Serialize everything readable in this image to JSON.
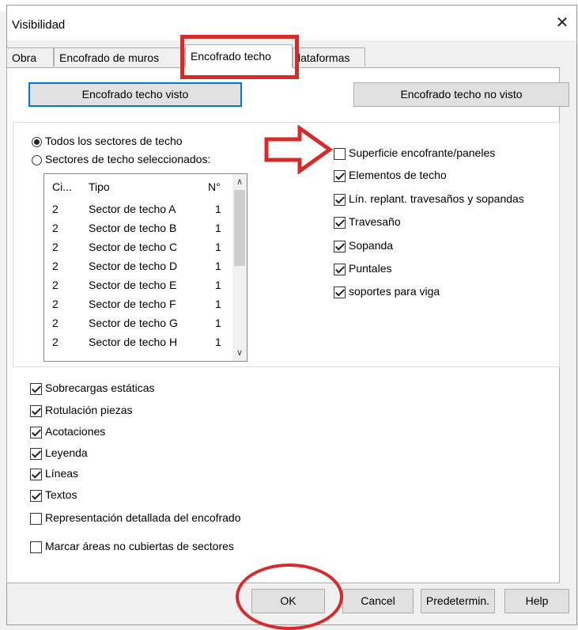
{
  "window": {
    "title": "Visibilidad",
    "close_glyph": "✕"
  },
  "tabs": [
    {
      "label": "Obra",
      "active": false
    },
    {
      "label": "Encofrado de muros",
      "active": false
    },
    {
      "label": "Encofrado techo",
      "active": true
    },
    {
      "label": "lataformas",
      "active": false
    }
  ],
  "top_buttons": {
    "visible": "Encofrado techo visto",
    "not_visible": "Encofrado techo no visto"
  },
  "sector_radios": [
    {
      "label": "Todos los sectores de techo",
      "selected": true
    },
    {
      "label": "Sectores de techo seleccionados:",
      "selected": false
    }
  ],
  "sector_list": {
    "headers": {
      "ci": "Ci...",
      "tipo": "Tipo",
      "n": "N°"
    },
    "rows": [
      {
        "ci": "2",
        "tipo": "Sector de techo A",
        "n": "1"
      },
      {
        "ci": "2",
        "tipo": "Sector de techo B",
        "n": "1"
      },
      {
        "ci": "2",
        "tipo": "Sector de techo C",
        "n": "1"
      },
      {
        "ci": "2",
        "tipo": "Sector de techo D",
        "n": "1"
      },
      {
        "ci": "2",
        "tipo": "Sector de techo E",
        "n": "1"
      },
      {
        "ci": "2",
        "tipo": "Sector de techo F",
        "n": "1"
      },
      {
        "ci": "2",
        "tipo": "Sector de techo G",
        "n": "1"
      },
      {
        "ci": "2",
        "tipo": "Sector de techo H",
        "n": "1"
      }
    ]
  },
  "element_checks": [
    {
      "label": "Superficie encofrante/paneles",
      "checked": false
    },
    {
      "label": "Elementos de techo",
      "checked": true
    },
    {
      "label": "Lín. replant. travesaños y sopandas",
      "checked": true
    },
    {
      "label": "Travesaño",
      "checked": true
    },
    {
      "label": "Sopanda",
      "checked": true
    },
    {
      "label": "Puntales",
      "checked": true
    },
    {
      "label": "soportes para viga",
      "checked": true
    }
  ],
  "general_checks": [
    {
      "label": "Sobrecargas estáticas",
      "checked": true
    },
    {
      "label": "Rotulación piezas",
      "checked": true
    },
    {
      "label": "Acotaciones",
      "checked": true
    },
    {
      "label": "Leyenda",
      "checked": true
    },
    {
      "label": "Líneas",
      "checked": true
    },
    {
      "label": "Textos",
      "checked": true
    },
    {
      "label": "Representación detallada del encofrado",
      "checked": false
    },
    {
      "label": "Marcar áreas no cubiertas de sectores",
      "checked": false
    }
  ],
  "footer_buttons": {
    "ok": "OK",
    "cancel": "Cancel",
    "default": "Predetermin.",
    "help": "Help"
  },
  "colors": {
    "annotation_red": "#d62b2b",
    "focus_blue": "#0078d7"
  }
}
